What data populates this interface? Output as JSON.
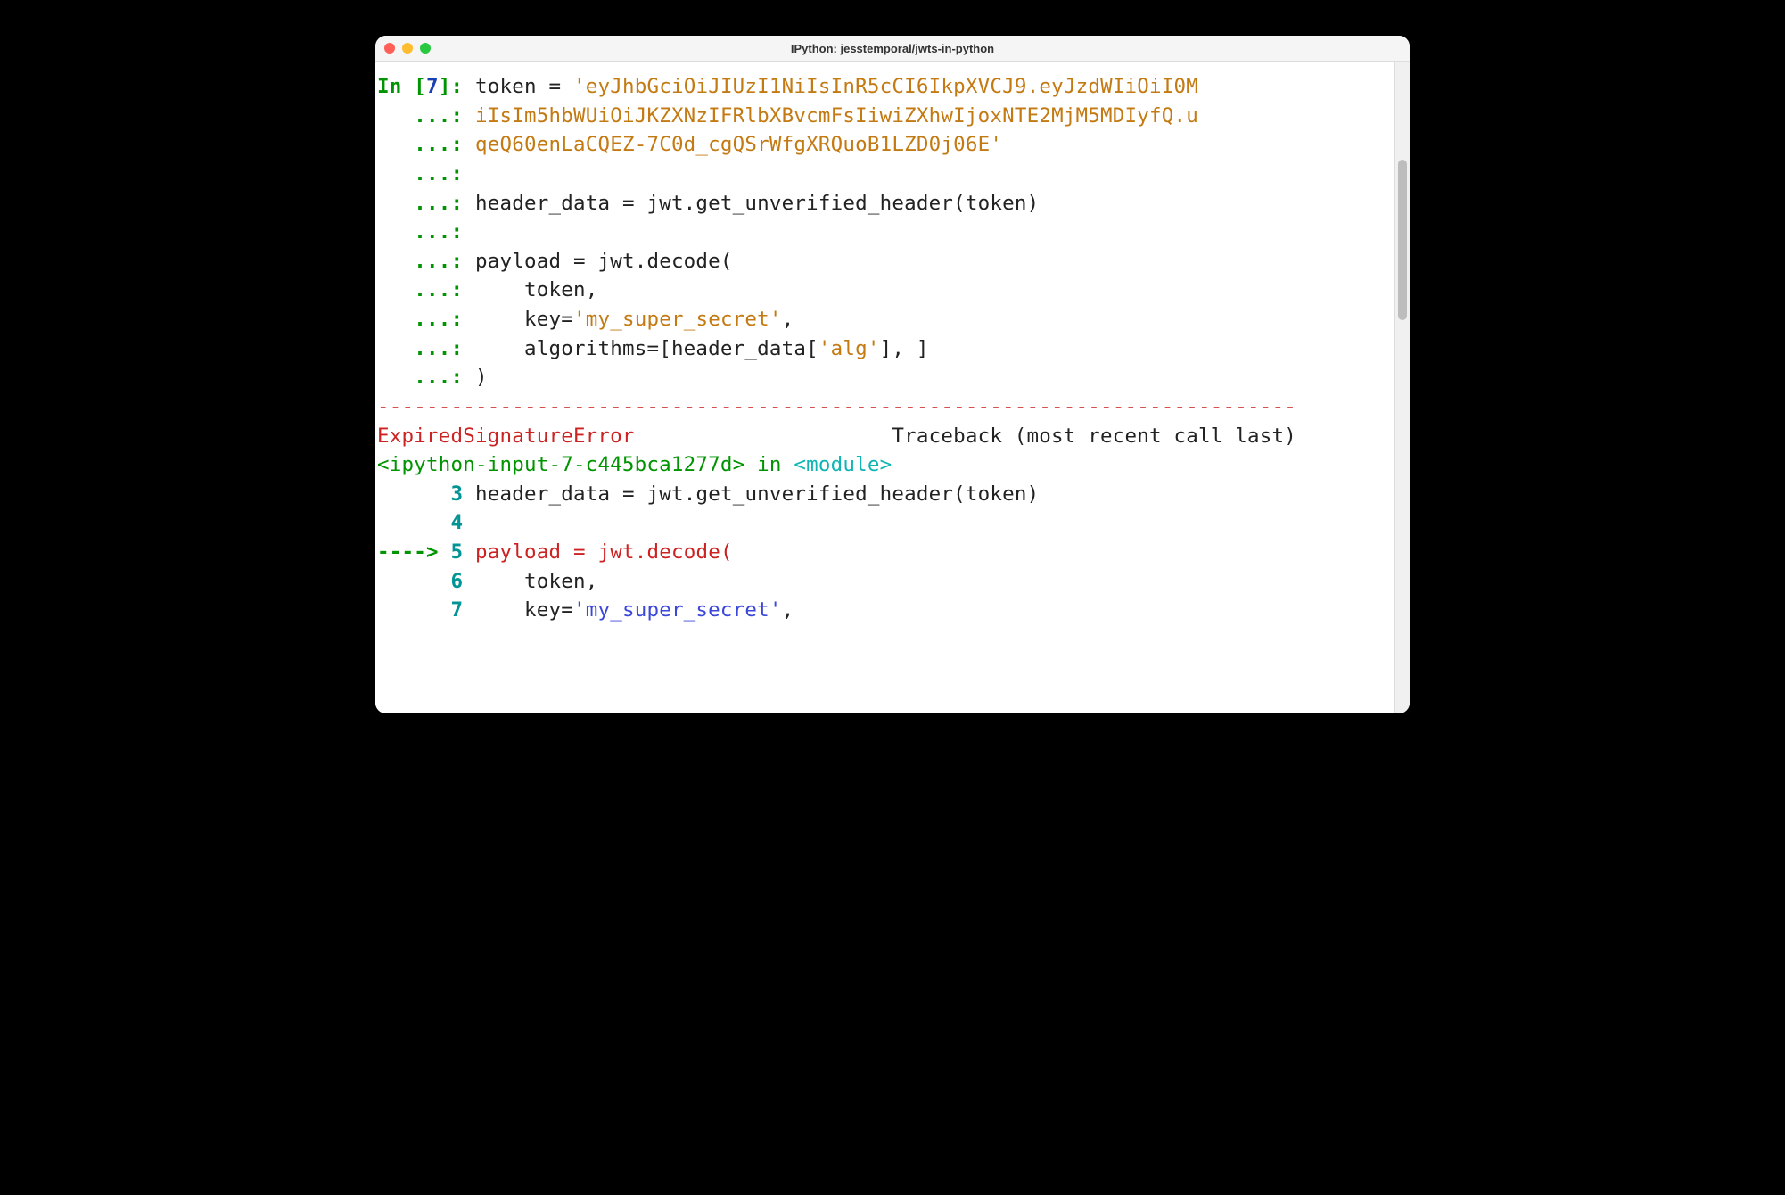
{
  "window": {
    "title": "IPython: jesstemporal/jwts-in-python"
  },
  "prompt": {
    "in_label": "In [",
    "in_num": "7",
    "in_close": "]:",
    "cont": "...:"
  },
  "code": {
    "l1a": "token = ",
    "l1b": "'eyJhbGciOiJIUzI1NiIsInR5cCI6IkpXVCJ9.eyJzdWIiOiI0M",
    "l2": "iIsIm5hbWUiOiJKZXNzIFRlbXBvcmFsIiwiZXhwIjoxNTE2MjM5MDIyfQ.u",
    "l3": "qeQ60enLaCQEZ-7C0d_cgQSrWfgXRQuoB1LZD0j06E'",
    "l5": "header_data = jwt.get_unverified_header(token)",
    "l7": "payload = jwt.decode(",
    "l8": "    token,",
    "l9a": "    key=",
    "l9b": "'my_super_secret'",
    "l9c": ",",
    "l10a": "    algorithms=[header_data[",
    "l10b": "'alg'",
    "l10c": "], ]",
    "l11": ")"
  },
  "traceback": {
    "divider": "---------------------------------------------------------------------------",
    "err_name": "ExpiredSignatureError",
    "err_pad": "                     ",
    "tb_label": "Traceback (most recent call last)",
    "ipy_ref": "<ipython-input-7-c445bca1277d>",
    "in_kw": " in ",
    "module": "<module>",
    "ln3": "      3 ",
    "t3": "header_data ",
    "t3b": "=",
    "t3c": " jwt",
    "t3d": ".",
    "t3e": "get_unverified_header",
    "t3f": "(",
    "t3g": "token",
    "t3h": ")",
    "ln4": "      4 ",
    "arrow": "----> ",
    "ln5": "5 ",
    "t5": "payload ",
    "t5b": "=",
    "t5c": " jwt",
    "t5d": ".",
    "t5e": "decode",
    "t5f": "(",
    "ln6": "      6 ",
    "t6": "    token",
    "t6b": ",",
    "ln7": "      7 ",
    "t7": "    key",
    "t7b": "=",
    "t7c": "'my_super_secret'",
    "t7d": ","
  }
}
